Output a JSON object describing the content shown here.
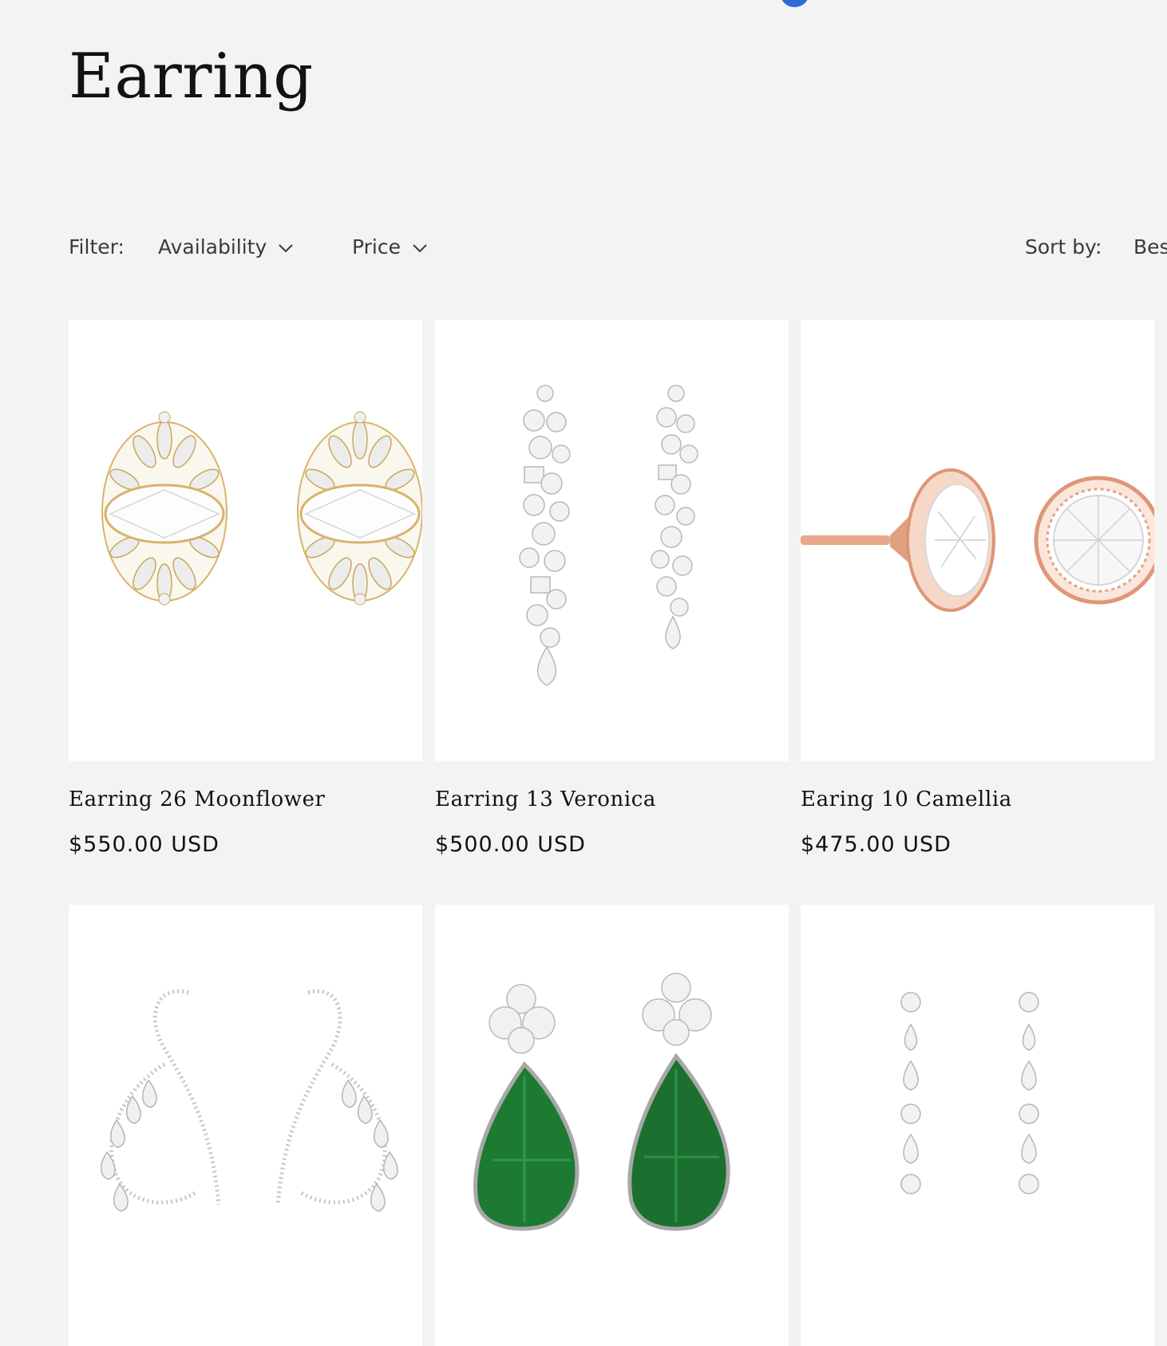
{
  "collection": {
    "title": "Earring"
  },
  "facets": {
    "filter_label": "Filter:",
    "filters": [
      {
        "label": "Availability",
        "icon": "chevron-down-icon"
      },
      {
        "label": "Price",
        "icon": "chevron-down-icon"
      }
    ],
    "sort_label": "Sort by:",
    "sort_value": "Bes"
  },
  "colors": {
    "background": "#f3f3f3",
    "card": "#ffffff",
    "accent_dot": "#2c6bd6"
  },
  "products": [
    {
      "title": "Earring 26 Moonflower",
      "price": "$550.00 USD"
    },
    {
      "title": "Earring 13 Veronica",
      "price": "$500.00 USD"
    },
    {
      "title": "Earing 10 Camellia",
      "price": "$475.00 USD"
    },
    {
      "title": "",
      "price": ""
    },
    {
      "title": "",
      "price": ""
    },
    {
      "title": "",
      "price": ""
    }
  ]
}
